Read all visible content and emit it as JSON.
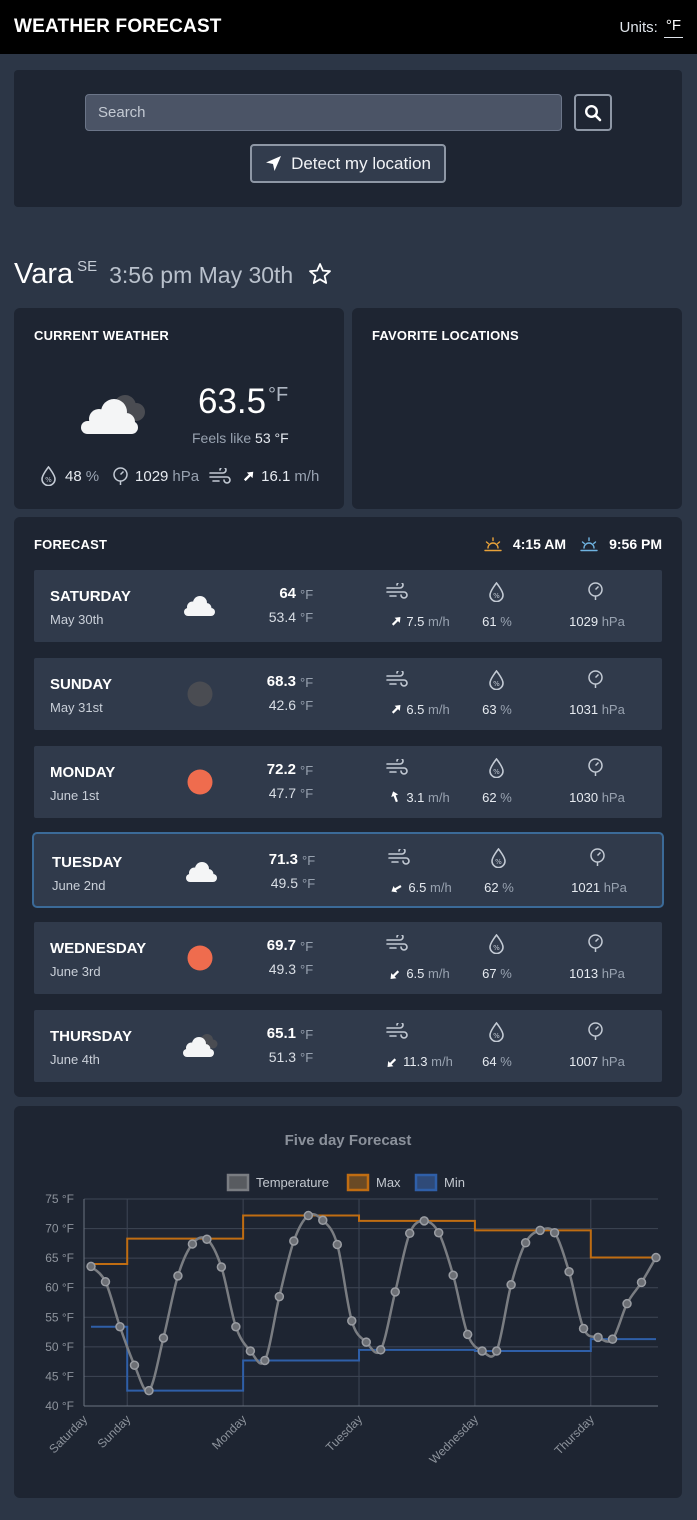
{
  "header": {
    "title": "WEATHER FORECAST",
    "units_label": "Units:",
    "units_value": "°F"
  },
  "search": {
    "placeholder": "Search",
    "detect_label": "Detect my location"
  },
  "location": {
    "name": "Vara",
    "country": "SE",
    "time": "3:56 pm May 30th"
  },
  "current": {
    "title": "CURRENT WEATHER",
    "temp": "63.5",
    "unit": "°F",
    "feels_label": "Feels like",
    "feels_value": "53 °F",
    "humidity": "48",
    "humidity_unit": "%",
    "pressure": "1029",
    "pressure_unit": "hPa",
    "wind": "16.1",
    "wind_unit": "m/h"
  },
  "favorites": {
    "title": "FAVORITE LOCATIONS"
  },
  "forecast": {
    "title": "FORECAST",
    "sunrise": "4:15 AM",
    "sunset": "9:56 PM",
    "days": [
      {
        "name": "SATURDAY",
        "date": "May 30th",
        "icon": "cloud-icon",
        "max": "64",
        "min": "53.4",
        "unit": "°F",
        "wind": "7.5",
        "wind_unit": "m/h",
        "wind_dir_deg": 45,
        "humidity": "61",
        "humidity_unit": "%",
        "pressure": "1029",
        "pressure_unit": "hPa"
      },
      {
        "name": "SUNDAY",
        "date": "May 31st",
        "icon": "dark-circle-icon",
        "max": "68.3",
        "min": "42.6",
        "unit": "°F",
        "wind": "6.5",
        "wind_unit": "m/h",
        "wind_dir_deg": 45,
        "humidity": "63",
        "humidity_unit": "%",
        "pressure": "1031",
        "pressure_unit": "hPa"
      },
      {
        "name": "MONDAY",
        "date": "June 1st",
        "icon": "sun-icon",
        "max": "72.2",
        "min": "47.7",
        "unit": "°F",
        "wind": "3.1",
        "wind_unit": "m/h",
        "wind_dir_deg": -20,
        "humidity": "62",
        "humidity_unit": "%",
        "pressure": "1030",
        "pressure_unit": "hPa"
      },
      {
        "name": "TUESDAY",
        "date": "June 2nd",
        "icon": "cloud-icon",
        "max": "71.3",
        "min": "49.5",
        "unit": "°F",
        "wind": "6.5",
        "wind_unit": "m/h",
        "wind_dir_deg": 240,
        "humidity": "62",
        "humidity_unit": "%",
        "pressure": "1021",
        "pressure_unit": "hPa"
      },
      {
        "name": "WEDNESDAY",
        "date": "June 3rd",
        "icon": "sun-icon",
        "max": "69.7",
        "min": "49.3",
        "unit": "°F",
        "wind": "6.5",
        "wind_unit": "m/h",
        "wind_dir_deg": 225,
        "humidity": "67",
        "humidity_unit": "%",
        "pressure": "1013",
        "pressure_unit": "hPa"
      },
      {
        "name": "THURSDAY",
        "date": "June 4th",
        "icon": "cloudy-icon",
        "max": "65.1",
        "min": "51.3",
        "unit": "°F",
        "wind": "11.3",
        "wind_unit": "m/h",
        "wind_dir_deg": 225,
        "humidity": "64",
        "humidity_unit": "%",
        "pressure": "1007",
        "pressure_unit": "hPa"
      }
    ],
    "selected_index": 3
  },
  "colors": {
    "temperature": "#7a7d82",
    "max": "#c06d12",
    "min": "#2f5fa8",
    "sun": "#ef6c4e",
    "sunrise_icon": "#e8a23a",
    "sunset_icon": "#6fb3e0"
  },
  "chart_data": {
    "type": "line",
    "title": "Five day Forecast",
    "legend": [
      "Temperature",
      "Max",
      "Min"
    ],
    "legend_position": "top",
    "grid": true,
    "yticks": [
      "75 °F",
      "70 °F",
      "65 °F",
      "60 °F",
      "55 °F",
      "50 °F",
      "45 °F",
      "40 °F"
    ],
    "ylim": [
      40,
      75
    ],
    "x_tick_labels": [
      "Saturday",
      "Sunday",
      "Monday",
      "Tuesday",
      "Wednesday",
      "Thursday"
    ],
    "x_tick_index": [
      0,
      3,
      11,
      19,
      27,
      35
    ],
    "series": [
      {
        "name": "Temperature",
        "values": [
          63.6,
          61,
          53.4,
          46.9,
          42.6,
          51.5,
          62,
          67.4,
          68.2,
          63.5,
          53.4,
          49.3,
          47.7,
          58.5,
          67.9,
          72.2,
          71.4,
          67.3,
          54.4,
          50.8,
          49.5,
          59.3,
          69.2,
          71.3,
          69.3,
          62.1,
          52.1,
          49.3,
          49.3,
          60.5,
          67.6,
          69.7,
          69.3,
          62.7,
          53.1,
          51.6,
          51.3,
          57.3,
          60.9,
          65.1
        ]
      },
      {
        "name": "Max",
        "values": [
          64,
          64,
          64,
          68.3,
          68.3,
          68.3,
          68.3,
          68.3,
          68.3,
          68.3,
          68.3,
          72.2,
          72.2,
          72.2,
          72.2,
          72.2,
          72.2,
          72.2,
          72.2,
          71.3,
          71.3,
          71.3,
          71.3,
          71.3,
          71.3,
          71.3,
          71.3,
          69.7,
          69.7,
          69.7,
          69.7,
          69.7,
          69.7,
          69.7,
          69.7,
          65.1,
          65.1,
          65.1,
          65.1,
          65.1
        ]
      },
      {
        "name": "Min",
        "values": [
          53.4,
          53.4,
          53.4,
          42.6,
          42.6,
          42.6,
          42.6,
          42.6,
          42.6,
          42.6,
          42.6,
          47.7,
          47.7,
          47.7,
          47.7,
          47.7,
          47.7,
          47.7,
          47.7,
          49.5,
          49.5,
          49.5,
          49.5,
          49.5,
          49.5,
          49.5,
          49.5,
          49.3,
          49.3,
          49.3,
          49.3,
          49.3,
          49.3,
          49.3,
          49.3,
          51.3,
          51.3,
          51.3,
          51.3,
          51.3
        ]
      }
    ]
  }
}
